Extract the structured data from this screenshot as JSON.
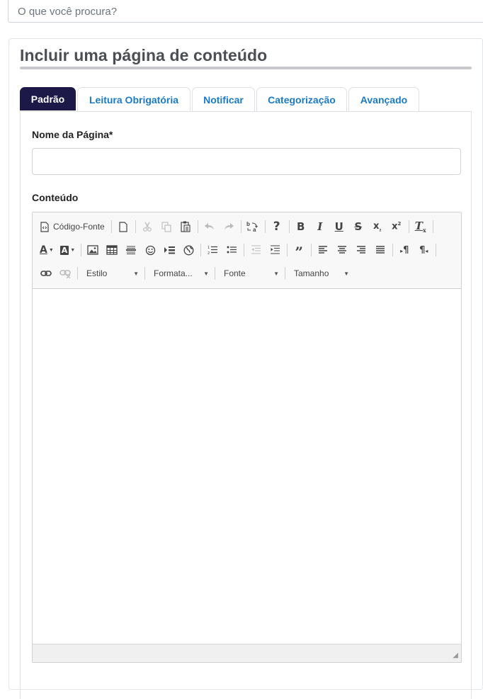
{
  "search": {
    "placeholder": "O que você procura?"
  },
  "page": {
    "title": "Incluir uma página de conteúdo"
  },
  "tabs": [
    {
      "label": "Padrão",
      "active": true
    },
    {
      "label": "Leitura Obrigatória",
      "active": false
    },
    {
      "label": "Notificar",
      "active": false
    },
    {
      "label": "Categorização",
      "active": false
    },
    {
      "label": "Avançado",
      "active": false
    }
  ],
  "form": {
    "name_label": "Nome da Página*",
    "name_value": "",
    "content_label": "Conteúdo"
  },
  "editor": {
    "source_label": "Código-Fonte",
    "combos": {
      "style": "Estilo",
      "format": "Formata...",
      "font": "Fonte",
      "size": "Tamanho"
    },
    "icons_row1": [
      "source-code-icon",
      "new-page-icon",
      "cut-icon",
      "copy-icon",
      "paste-icon",
      "undo-icon",
      "redo-icon",
      "find-replace-icon",
      "help-icon",
      "bold-icon",
      "italic-icon",
      "underline-icon",
      "strikethrough-icon",
      "subscript-icon",
      "superscript-icon",
      "remove-format-icon"
    ],
    "icons_row2": [
      "text-color-icon",
      "background-color-icon",
      "image-icon",
      "table-icon",
      "horizontal-line-icon",
      "smiley-icon",
      "page-break-icon",
      "iframe-icon",
      "numbered-list-icon",
      "bulleted-list-icon",
      "decrease-indent-icon",
      "increase-indent-icon",
      "blockquote-icon",
      "align-left-icon",
      "align-center-icon",
      "align-right-icon",
      "justify-icon",
      "ltr-icon",
      "rtl-icon"
    ],
    "icons_row3": [
      "link-icon",
      "unlink-icon"
    ]
  },
  "colors": {
    "active_tab_bg": "#1c1847",
    "tab_text": "#1a7ac6",
    "title_text": "#4b4f54"
  }
}
